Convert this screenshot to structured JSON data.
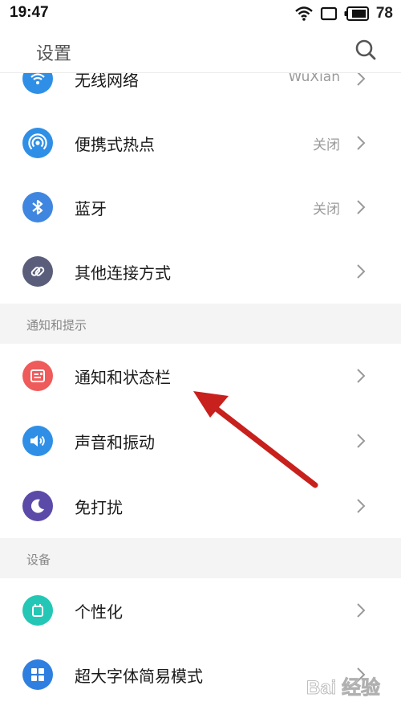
{
  "status_bar": {
    "time": "19:47",
    "battery": "78"
  },
  "header": {
    "title": "设置"
  },
  "rows_top": [
    {
      "label": "无线网络",
      "value": "WuXian",
      "color": "#2f8fe6"
    },
    {
      "label": "便携式热点",
      "value": "关闭",
      "color": "#2f8fe6"
    },
    {
      "label": "蓝牙",
      "value": "关闭",
      "color": "#3f86e0"
    },
    {
      "label": "其他连接方式",
      "value": "",
      "color": "#5a5e7a"
    }
  ],
  "section_notify": {
    "title": "通知和提示",
    "items": [
      {
        "label": "通知和状态栏",
        "color": "#ef5a5a"
      },
      {
        "label": "声音和振动",
        "color": "#2f8fe6"
      },
      {
        "label": "免打扰",
        "color": "#5b4aa8"
      }
    ]
  },
  "section_device": {
    "title": "设备",
    "items": [
      {
        "label": "个性化",
        "color": "#24c7b5"
      },
      {
        "label": "超大字体简易模式",
        "color": "#2f7fe0"
      }
    ]
  },
  "watermark": {
    "text": "Bai 经验"
  },
  "icons": [
    "wifi-icon",
    "hotspot-icon",
    "bluetooth-icon",
    "link-icon",
    "notification-icon",
    "speaker-icon",
    "moon-icon",
    "personalize-icon",
    "grid-icon",
    "search-icon",
    "chevron-right-icon"
  ]
}
